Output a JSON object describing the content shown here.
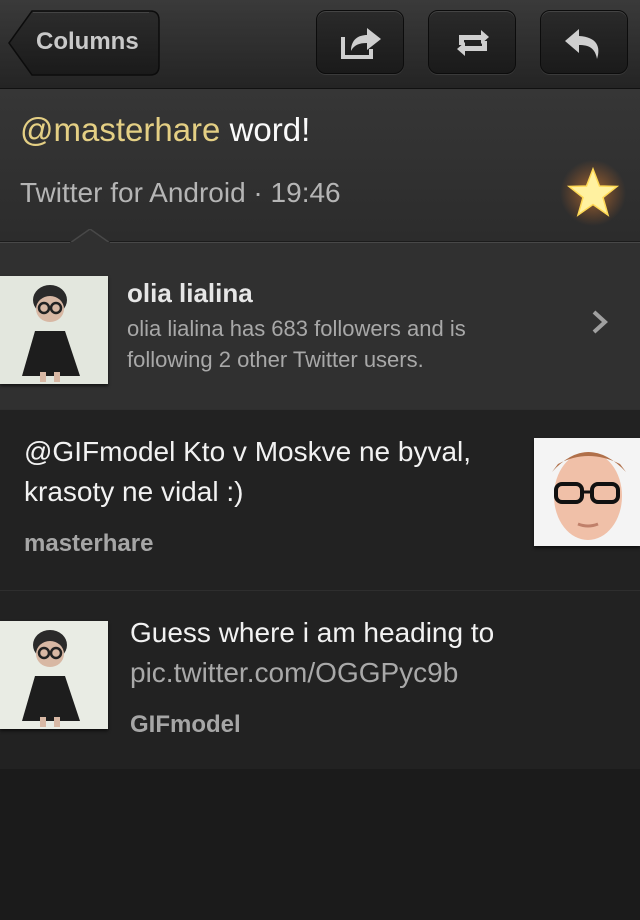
{
  "nav": {
    "back_label": "Columns",
    "icons": [
      "share-icon",
      "retweet-icon",
      "reply-icon"
    ]
  },
  "detail": {
    "mention": "@masterhare",
    "text": " word!",
    "source": "Twitter for Android",
    "separator": " · ",
    "time": "19:46",
    "favorited": true
  },
  "profile": {
    "name": "olia lialina",
    "description": "olia lialina has 683 followers and is following 2 other Twitter users."
  },
  "timeline": [
    {
      "text": "@GIFmodel Kto v Moskve ne byval, krasoty ne vidal :)",
      "user": "masterhare"
    },
    {
      "text": "Guess where i am heading to",
      "link": "pic.twitter.com/OGGPyc9b",
      "user": "GIFmodel"
    }
  ],
  "colors": {
    "mention": "#e4cf84",
    "star": "#ffe36a",
    "background": "#1b1b1b"
  }
}
